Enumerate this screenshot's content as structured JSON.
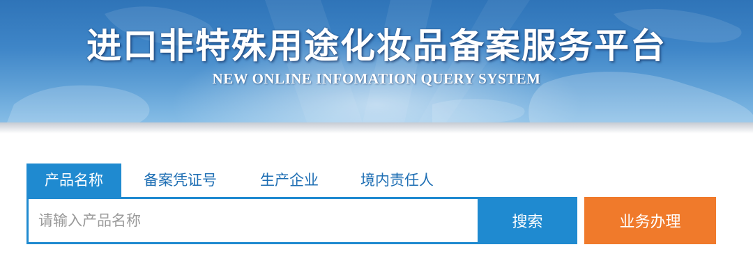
{
  "banner": {
    "title": "进口非特殊用途化妆品备案服务平台",
    "subtitle": "NEW ONLINE INFOMATION QUERY SYSTEM"
  },
  "tabs": [
    {
      "label": "产品名称",
      "active": true
    },
    {
      "label": "备案凭证号",
      "active": false
    },
    {
      "label": "生产企业",
      "active": false
    },
    {
      "label": "境内责任人",
      "active": false
    }
  ],
  "search": {
    "placeholder": "请输入产品名称",
    "value": "",
    "button_label": "搜索"
  },
  "business_button_label": "业务办理",
  "colors": {
    "accent_blue": "#1f8ad0",
    "tab_text": "#1f6fb4",
    "orange_button": "#f07a2b",
    "banner_blue": "#3f86c8"
  },
  "icons": [
    "world-map-graphic"
  ]
}
